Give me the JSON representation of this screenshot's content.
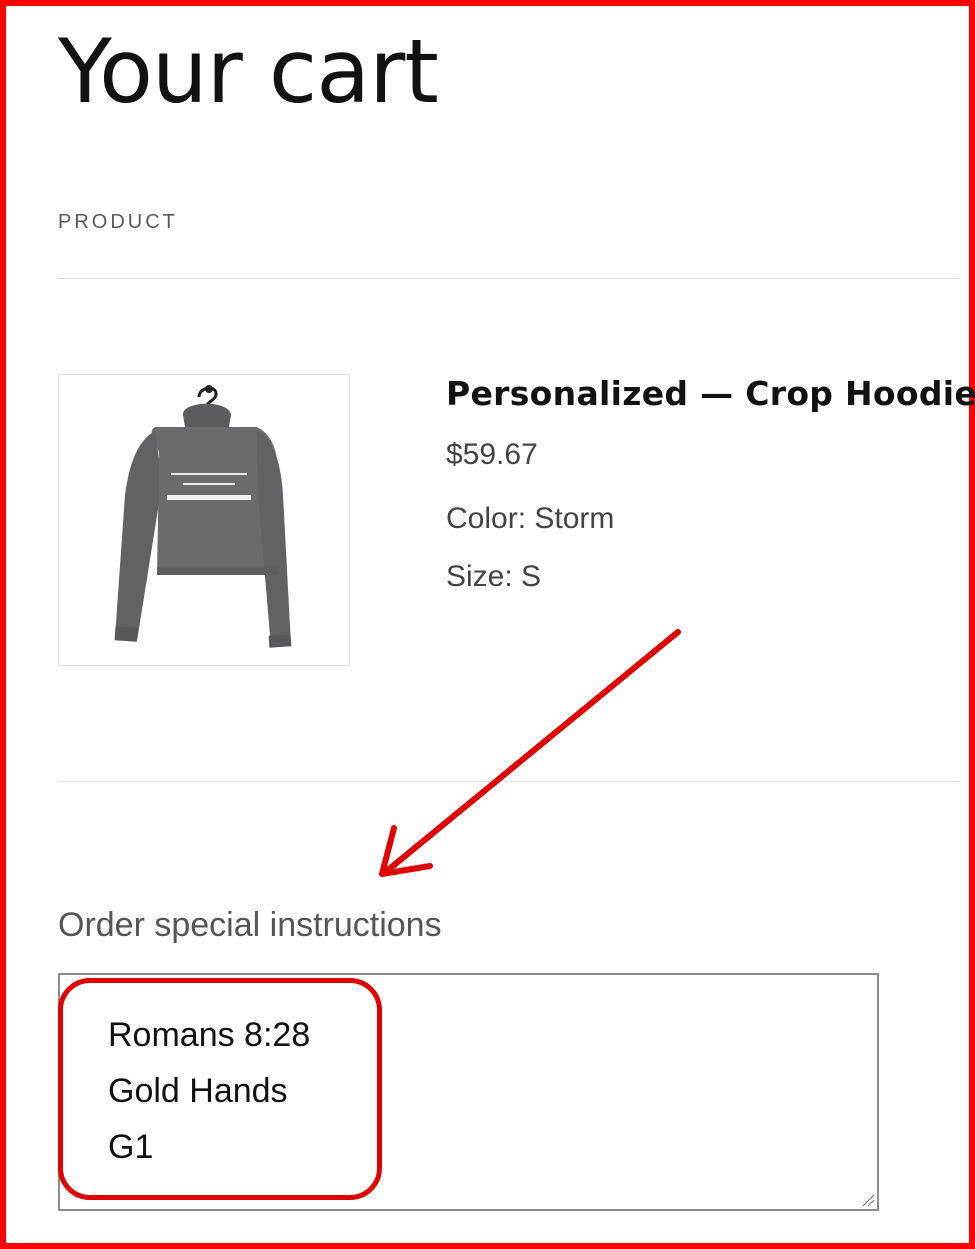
{
  "page": {
    "title": "Your cart"
  },
  "table": {
    "header_product": "PRODUCT"
  },
  "cart_item": {
    "image_icon": "crop-hoodie-product-image",
    "name": "Personalized — Crop Hoodie",
    "price": "$59.67",
    "options": [
      "Color: Storm",
      "Size: S"
    ],
    "color_hex": "#6b6b6d"
  },
  "instructions": {
    "label": "Order special instructions",
    "lines": [
      "Romans 8:28",
      "Gold Hands",
      "G1"
    ]
  },
  "annotations": {
    "frame_color": "#ff0000",
    "arrow_color": "#e00000"
  }
}
